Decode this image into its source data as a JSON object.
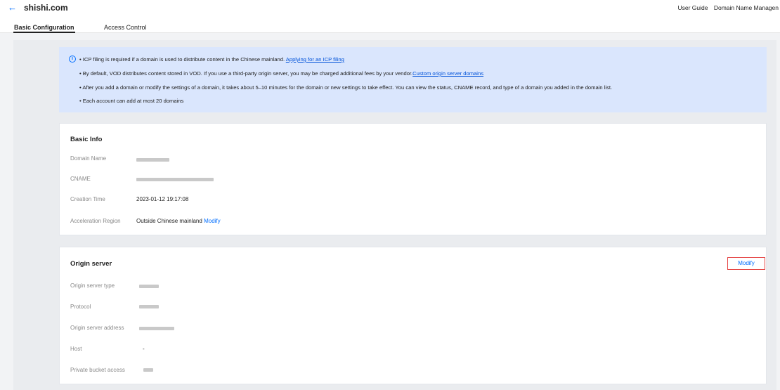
{
  "header": {
    "back_icon": "←",
    "title": "shishi.com",
    "links": [
      "User Guide",
      "Domain Name Managen"
    ]
  },
  "tabs": [
    {
      "label": "Basic Configuration",
      "active": true
    },
    {
      "label": "Access Control",
      "active": false
    }
  ],
  "notice": {
    "icon": "i",
    "line1_text": "• ICP filing is required if a domain is used to distribute content in the Chinese mainland. ",
    "line1_link": "Applying for an ICP filing",
    "line2_text": "• By default, VOD distributes content stored in VOD. If you use a third-party origin server, you may be charged additional fees by your vendor.",
    "line2_link": "Custom origin server domains",
    "line3_text": "• After you add a domain or modify the settings of a domain, it takes about 5–10 minutes for the domain or new settings to take effect. You can view the status, CNAME record, and type of a domain you added in the domain list.",
    "line4_text": "• Each account can add at most 20 domains"
  },
  "basic_info": {
    "title": "Basic Info",
    "domain_name_label": "Domain Name",
    "cname_label": "CNAME",
    "creation_time_label": "Creation Time",
    "creation_time_value": "2023-01-12 19:17:08",
    "acceleration_region_label": "Acceleration Region",
    "acceleration_region_value": "Outside Chinese mainland",
    "modify_link": "Modify"
  },
  "origin_server": {
    "title": "Origin server",
    "modify_button": "Modify",
    "type_label": "Origin server type",
    "protocol_label": "Protocol",
    "address_label": "Origin server address",
    "host_label": "Host",
    "host_value": "-",
    "private_bucket_label": "Private bucket access"
  }
}
